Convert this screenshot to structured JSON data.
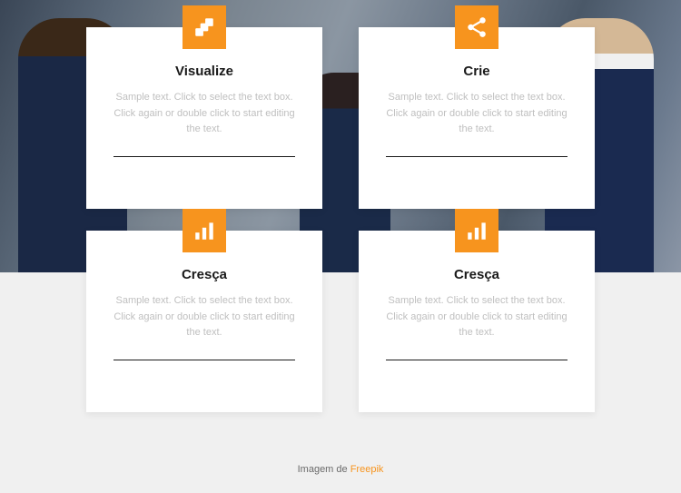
{
  "cards": [
    {
      "title": "Visualize",
      "desc": "Sample text. Click to select the text box. Click again or double click to start editing the text.",
      "icon": "layers"
    },
    {
      "title": "Crie",
      "desc": "Sample text. Click to select the text box. Click again or double click to start editing the text.",
      "icon": "share"
    },
    {
      "title": "Cresça",
      "desc": "Sample text. Click to select the text box. Click again or double click to start editing the text.",
      "icon": "chart"
    },
    {
      "title": "Cresça",
      "desc": "Sample text. Click to select the text box. Click again or double click to start editing the text.",
      "icon": "chart"
    }
  ],
  "credit": {
    "prefix": "Imagem de ",
    "link": "Freepik"
  },
  "colors": {
    "accent": "#f7941e"
  }
}
